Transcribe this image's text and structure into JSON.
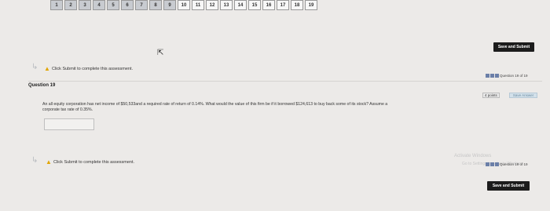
{
  "question_nav": [
    {
      "label": "1",
      "state": "done"
    },
    {
      "label": "2",
      "state": "done"
    },
    {
      "label": "3",
      "state": "done"
    },
    {
      "label": "4",
      "state": "done"
    },
    {
      "label": "5",
      "state": "done"
    },
    {
      "label": "6",
      "state": "done"
    },
    {
      "label": "7",
      "state": "done"
    },
    {
      "label": "8",
      "state": "done"
    },
    {
      "label": "9",
      "state": "done"
    },
    {
      "label": "10",
      "state": "open"
    },
    {
      "label": "11",
      "state": "open"
    },
    {
      "label": "12",
      "state": "open"
    },
    {
      "label": "13",
      "state": "open"
    },
    {
      "label": "14",
      "state": "open"
    },
    {
      "label": "15",
      "state": "open"
    },
    {
      "label": "16",
      "state": "open"
    },
    {
      "label": "17",
      "state": "open"
    },
    {
      "label": "18",
      "state": "open"
    },
    {
      "label": "19",
      "state": "open"
    }
  ],
  "save_submit_label": "Save and Submit",
  "notice": "Click Submit to complete this assessment.",
  "question": {
    "title": "Question 19",
    "counter": "Question 19 of 19",
    "points": "4 points",
    "save_answer": "Save Answer",
    "text_line1": "An all equity corporation has net income of $50,533and a required rate of return of 0.14%. What would the value of this firm be if it borrowed $124,613 to buy back some of its stock? Assume a",
    "text_line2": "corporate tax rate of 0.35%."
  },
  "watermark_line1": "Activate Windows",
  "watermark_line2": "Go to Settings to activate Windows.",
  "colors": {
    "accent": "#6b7fa8",
    "warning": "#e1a500",
    "button": "#1c1c1c"
  }
}
